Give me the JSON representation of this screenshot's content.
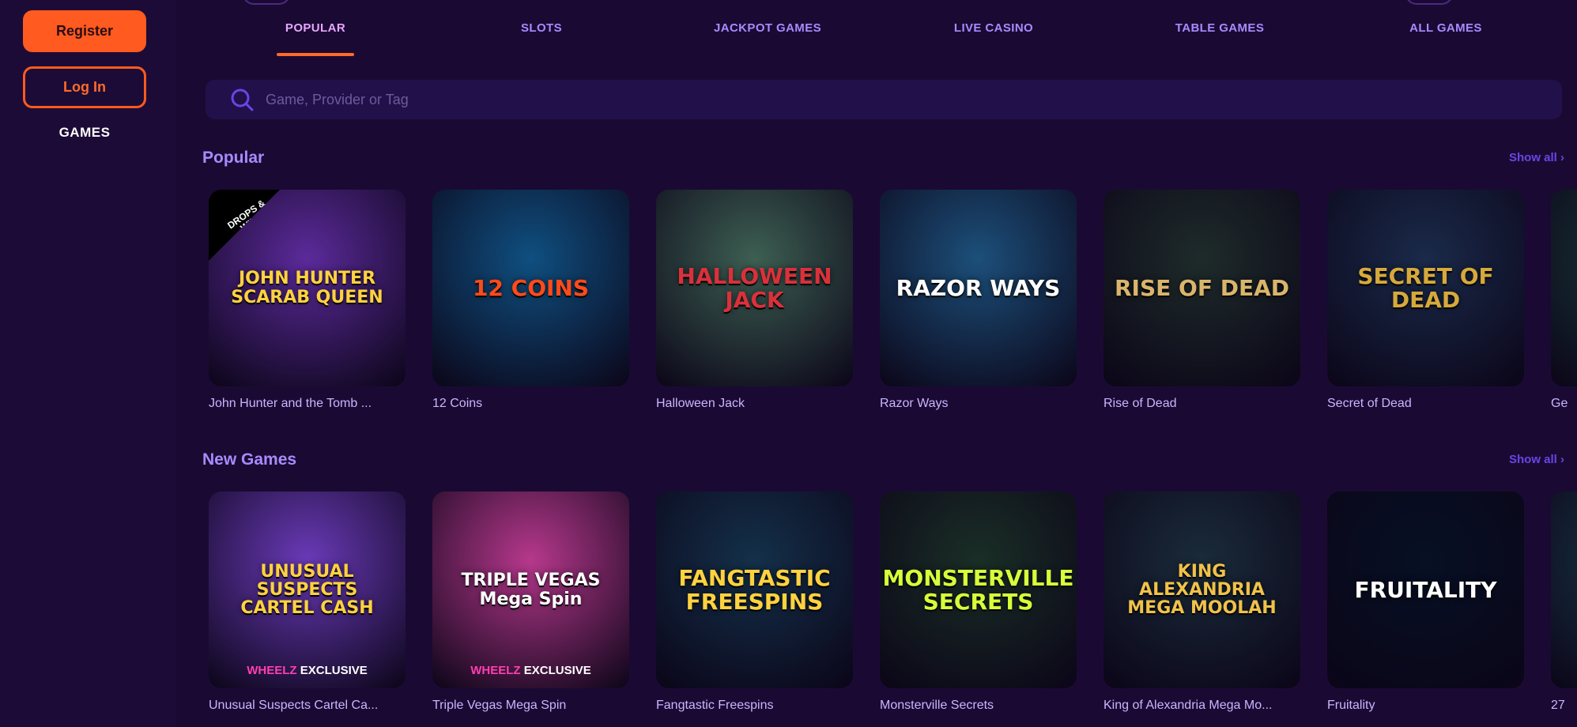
{
  "sidebar": {
    "register_label": "Register",
    "login_label": "Log In",
    "games_label": "GAMES"
  },
  "tabs": [
    {
      "label": "POPULAR",
      "active": true
    },
    {
      "label": "SLOTS"
    },
    {
      "label": "JACKPOT GAMES"
    },
    {
      "label": "LIVE CASINO"
    },
    {
      "label": "TABLE GAMES"
    },
    {
      "label": "ALL GAMES"
    }
  ],
  "search": {
    "placeholder": "Game, Provider or Tag",
    "icon": "search-icon"
  },
  "sections": [
    {
      "title": "Popular",
      "show_all": "Show all ›",
      "games": [
        {
          "name": "John Hunter and the Tomb ...",
          "art": "JOHN HUNTER\nSCARAB QUEEN",
          "badge": "DROPS & WINS",
          "bg": "#5b2a9a",
          "accent": "#ffd23f"
        },
        {
          "name": "12 Coins",
          "art": "12 COINS",
          "bg": "#0f4f80",
          "accent": "#ff4a1a"
        },
        {
          "name": "Halloween Jack",
          "art": "HALLOWEEN JACK",
          "bg": "#3d5f52",
          "accent": "#d9313b"
        },
        {
          "name": "Razor Ways",
          "art": "RAZOR WAYS",
          "bg": "#1c4f7a",
          "accent": "#ffffff"
        },
        {
          "name": "Rise of Dead",
          "art": "RISE OF DEAD",
          "bg": "#1e2b2a",
          "accent": "#d9b56c"
        },
        {
          "name": "Secret of Dead",
          "art": "SECRET OF DEAD",
          "bg": "#1a2a4a",
          "accent": "#d6a93c"
        },
        {
          "name": "Ge",
          "art": "",
          "bg": "#1a3a3a",
          "accent": "#ffffff"
        }
      ]
    },
    {
      "title": "New Games",
      "show_all": "Show all ›",
      "games": [
        {
          "name": "Unusual Suspects Cartel Ca...",
          "art": "UNUSUAL SUSPECTS\nCARTEL CASH",
          "wheelz": true,
          "bg": "#6a3ab8",
          "accent": "#ffd23f"
        },
        {
          "name": "Triple Vegas Mega Spin",
          "art": "TRIPLE VEGAS\nMega Spin",
          "wheelz": true,
          "bg": "#b6388c",
          "accent": "#ffffff"
        },
        {
          "name": "Fangtastic Freespins",
          "art": "FANGTASTIC\nFREESPINS",
          "bg": "#14304a",
          "accent": "#ffd23f"
        },
        {
          "name": "Monsterville Secrets",
          "art": "MONSTERVILLE\nSECRETS",
          "bg": "#1a2e26",
          "accent": "#d7ff3a"
        },
        {
          "name": "King of Alexandria Mega Mo...",
          "art": "KING\nALEXANDRIA\nMEGA MOOLAH",
          "bg": "#1a2b3a",
          "accent": "#f0c24a"
        },
        {
          "name": "Fruitality",
          "art": "FRUITALITY",
          "bg": "#071024",
          "accent": "#ffffff"
        },
        {
          "name": "27",
          "art": "",
          "bg": "#1a3a4a",
          "accent": "#ffffff"
        }
      ]
    }
  ],
  "wheelz": {
    "brand": "WHEELZ",
    "tag": "EXCLUSIVE"
  },
  "colors": {
    "accent": "#ff5a1f",
    "tab_text": "#a98aff",
    "background": "#1a0a33"
  }
}
